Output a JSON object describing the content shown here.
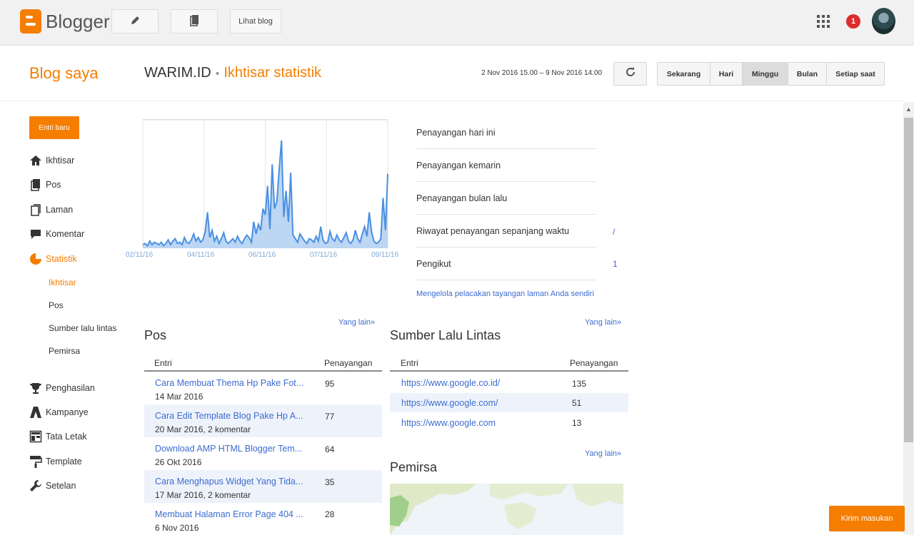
{
  "topbar": {
    "logo_text": "Blogger",
    "view_blog_label": "Lihat blog",
    "notification_count": "1"
  },
  "header": {
    "blog_saya": "Blog saya",
    "blog_name": "WARIM.ID",
    "page_title": "Ikhtisar statistik",
    "date_range": "2 Nov 2016 15.00 – 9 Nov 2016 14.00",
    "ranges": [
      "Sekarang",
      "Hari",
      "Minggu",
      "Bulan",
      "Setiap saat"
    ],
    "active_range": "Minggu"
  },
  "sidebar": {
    "new_post": "Entri baru",
    "items": [
      {
        "label": "Ikhtisar",
        "icon": "home-icon"
      },
      {
        "label": "Pos",
        "icon": "posts-icon"
      },
      {
        "label": "Laman",
        "icon": "pages-icon"
      },
      {
        "label": "Komentar",
        "icon": "comment-icon"
      },
      {
        "label": "Statistik",
        "icon": "pie-chart-icon"
      }
    ],
    "sub_items": [
      "Ikhtisar",
      "Pos",
      "Sumber lalu lintas",
      "Pemirsa"
    ],
    "items2": [
      {
        "label": "Penghasilan",
        "icon": "trophy-icon"
      },
      {
        "label": "Kampanye",
        "icon": "campaign-icon"
      },
      {
        "label": "Tata Letak",
        "icon": "layout-icon"
      },
      {
        "label": "Template",
        "icon": "paint-roller-icon"
      },
      {
        "label": "Setelan",
        "icon": "wrench-icon"
      }
    ]
  },
  "chart_data": {
    "type": "area",
    "x_tick_labels": [
      "02/11/16",
      "04/11/16",
      "06/11/16",
      "07/11/16",
      "09/11/16"
    ],
    "values": [
      3,
      4,
      2,
      6,
      3,
      5,
      4,
      3,
      5,
      2,
      4,
      7,
      3,
      6,
      8,
      4,
      5,
      3,
      9,
      5,
      4,
      7,
      12,
      6,
      9,
      5,
      7,
      14,
      30,
      9,
      15,
      6,
      10,
      4,
      8,
      13,
      6,
      4,
      6,
      8,
      5,
      10,
      6,
      4,
      8,
      11,
      9,
      5,
      22,
      12,
      20,
      15,
      33,
      28,
      52,
      16,
      70,
      33,
      39,
      65,
      90,
      26,
      48,
      22,
      63,
      11,
      8,
      5,
      12,
      9,
      6,
      4,
      8,
      7,
      5,
      10,
      6,
      18,
      7,
      4,
      5,
      14,
      8,
      6,
      11,
      7,
      5,
      9,
      13,
      6,
      4,
      7,
      15,
      8,
      5,
      12,
      18,
      10,
      30,
      14,
      6,
      4,
      5,
      8,
      42,
      15,
      62
    ],
    "ylim": [
      0,
      100
    ],
    "color": "#4a90e2"
  },
  "stats": {
    "rows": [
      {
        "label": "Penayangan hari ini",
        "value": ""
      },
      {
        "label": "Penayangan kemarin",
        "value": ""
      },
      {
        "label": "Penayangan bulan lalu",
        "value": ""
      },
      {
        "label": "Riwayat penayangan sepanjang waktu",
        "value": "/"
      },
      {
        "label": "Pengikut",
        "value": "1"
      }
    ],
    "manage_link": "Mengelola pelacakan tayangan laman Anda sendiri"
  },
  "posts_panel": {
    "title": "Pos",
    "more": "Yang lain»",
    "col_entry": "Entri",
    "col_views": "Penayangan",
    "rows": [
      {
        "title": "Cara Membuat Thema Hp Pake Fot...",
        "meta": "14 Mar 2016",
        "views": "95"
      },
      {
        "title": "Cara Edit Template Blog Pake Hp A...",
        "meta": "20 Mar 2016, 2 komentar",
        "views": "77"
      },
      {
        "title": "Download AMP HTML Blogger Tem...",
        "meta": "26 Okt 2016",
        "views": "64"
      },
      {
        "title": "Cara Menghapus Widget Yang Tida...",
        "meta": "17 Mar 2016, 2 komentar",
        "views": "35"
      },
      {
        "title": "Membuat Halaman Error Page 404 ...",
        "meta": "6 Nov 2016",
        "views": "28"
      }
    ]
  },
  "traffic_panel": {
    "title": "Sumber Lalu Lintas",
    "more": "Yang lain»",
    "col_entry": "Entri",
    "col_views": "Penayangan",
    "rows": [
      {
        "source": "https://www.google.co.id/",
        "views": "135"
      },
      {
        "source": "https://www.google.com/",
        "views": "51"
      },
      {
        "source": "https://www.google.com",
        "views": "13"
      }
    ]
  },
  "audience_panel": {
    "title": "Pemirsa",
    "more": "Yang lain»"
  },
  "feedback": "Kirim masukan"
}
